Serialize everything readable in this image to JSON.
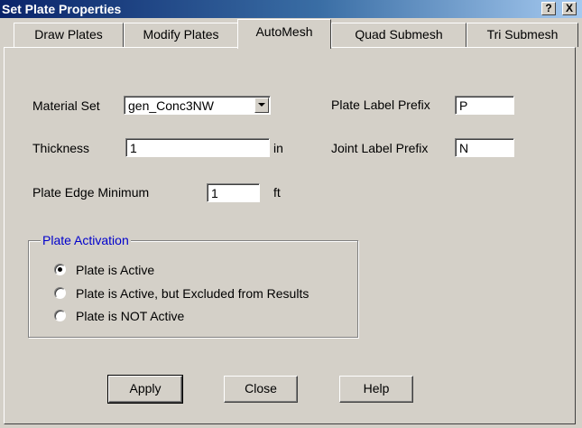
{
  "window": {
    "title": "Set Plate Properties",
    "help_label": "?",
    "close_label": "X"
  },
  "tabs": [
    {
      "label": "Draw Plates",
      "active": false
    },
    {
      "label": "Modify Plates",
      "active": false
    },
    {
      "label": "AutoMesh",
      "active": true
    },
    {
      "label": "Quad Submesh",
      "active": false
    },
    {
      "label": "Tri Submesh",
      "active": false
    }
  ],
  "form": {
    "material_set": {
      "label": "Material Set",
      "value": "gen_Conc3NW"
    },
    "thickness": {
      "label": "Thickness",
      "value": "1",
      "unit": "in"
    },
    "plate_edge_minimum": {
      "label": "Plate Edge Minimum",
      "value": "1",
      "unit": "ft"
    },
    "plate_label_prefix": {
      "label": "Plate Label Prefix",
      "value": "P"
    },
    "joint_label_prefix": {
      "label": "Joint Label Prefix",
      "value": "N"
    }
  },
  "activation": {
    "legend": "Plate Activation",
    "options": [
      {
        "label": "Plate is Active",
        "checked": true
      },
      {
        "label": "Plate is Active, but Excluded from Results",
        "checked": false
      },
      {
        "label": "Plate is NOT Active",
        "checked": false
      }
    ]
  },
  "buttons": {
    "apply": "Apply",
    "close": "Close",
    "help": "Help"
  }
}
